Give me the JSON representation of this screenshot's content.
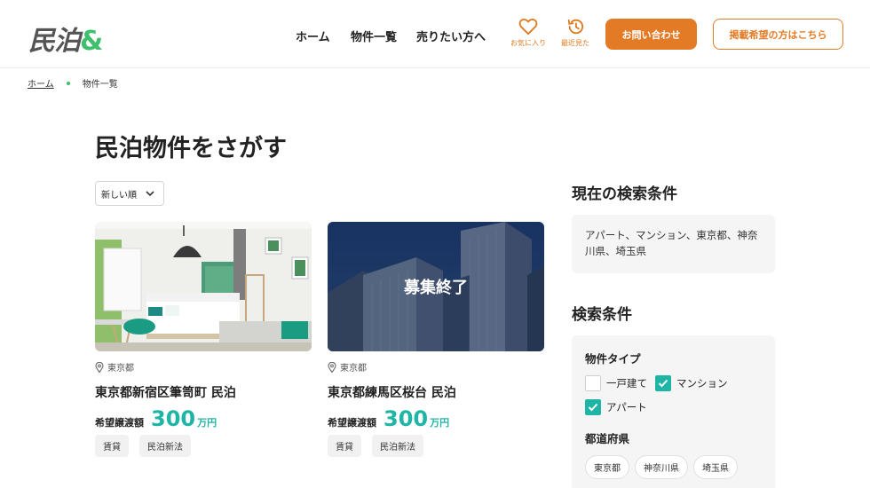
{
  "header": {
    "logo_text": "民泊",
    "logo_amp": "&",
    "nav": [
      "ホーム",
      "物件一覧",
      "売りたい方へ"
    ],
    "favorites_label": "お気に入り",
    "recent_label": "最近見た",
    "contact_button": "お問い合わせ",
    "listing_button": "掲載希望の方はこちら",
    "accent_color": "#e37b26",
    "brand_green": "#3dbf6e"
  },
  "breadcrumb": {
    "home": "ホーム",
    "current": "物件一覧"
  },
  "main": {
    "title": "民泊物件をさがす",
    "sort_label": "新しい順",
    "listings": [
      {
        "location": "東京都",
        "name": "東京都新宿区筆笥町 民泊",
        "price_label": "希望譲渡額",
        "price": "300",
        "unit": "万円",
        "tags": [
          "賃貸",
          "民泊新法"
        ],
        "closed_text": ""
      },
      {
        "location": "東京都",
        "name": "東京都練馬区桜台 民泊",
        "price_label": "希望譲渡額",
        "price": "300",
        "unit": "万円",
        "tags": [
          "賃貸",
          "民泊新法"
        ],
        "closed_text": "募集終了"
      }
    ]
  },
  "sidebar": {
    "current_heading": "現在の検索条件",
    "current_conditions": "アパート、マンション、東京都、神奈川県、埼玉県",
    "filter_heading": "検索条件",
    "property_type_heading": "物件タイプ",
    "property_types": [
      {
        "label": "一戸建て",
        "checked": false
      },
      {
        "label": "マンション",
        "checked": true
      },
      {
        "label": "アパート",
        "checked": true
      }
    ],
    "prefecture_heading": "都道府県",
    "prefectures": [
      "東京都",
      "神奈川県",
      "埼玉県"
    ]
  }
}
